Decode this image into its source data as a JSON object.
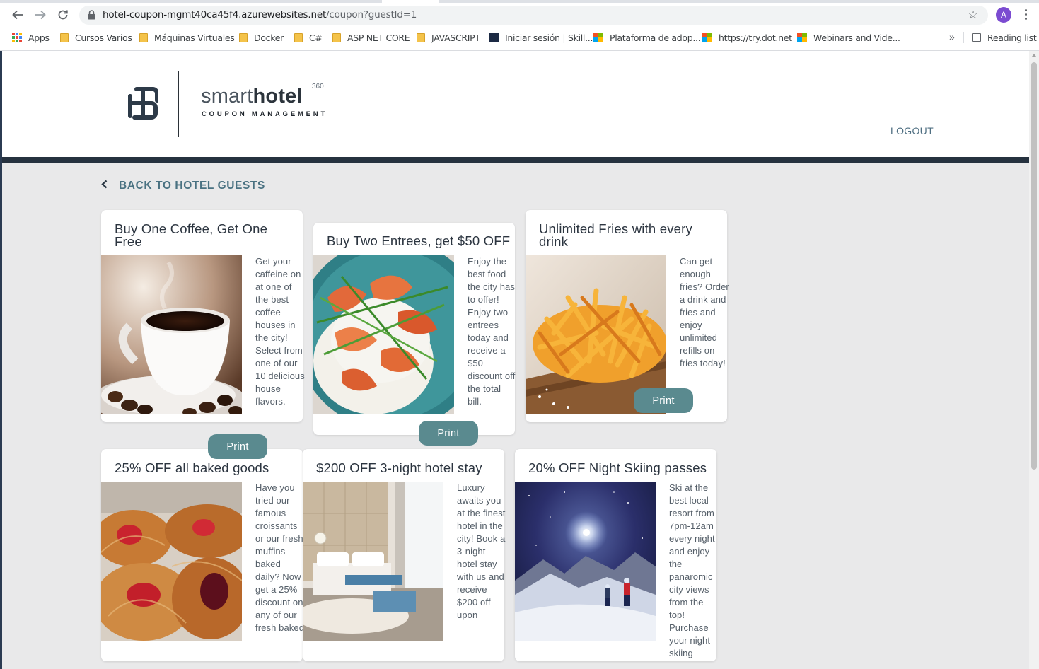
{
  "browser": {
    "url_host": "hotel-coupon-mgmt40ca45f4.azurewebsites.net",
    "url_path": "/coupon?guestId=1",
    "profile_initial": "A",
    "bookmarks": [
      {
        "label": "Apps",
        "icon": "apps-grid-icon"
      },
      {
        "label": "Cursos Varios",
        "icon": "folder-icon"
      },
      {
        "label": "Máquinas Virtuales",
        "icon": "folder-icon"
      },
      {
        "label": "Docker",
        "icon": "folder-icon"
      },
      {
        "label": "C#",
        "icon": "folder-icon"
      },
      {
        "label": "ASP NET CORE",
        "icon": "folder-icon"
      },
      {
        "label": "JAVASCRIPT",
        "icon": "folder-icon"
      },
      {
        "label": "Iniciar sesión | Skill...",
        "icon": "skillsoft-icon"
      },
      {
        "label": "Plataforma de adop...",
        "icon": "microsoft-icon"
      },
      {
        "label": "https://try.dot.net",
        "icon": "microsoft-icon"
      },
      {
        "label": "Webinars and Vide...",
        "icon": "microsoft-icon"
      }
    ],
    "reading_list": "Reading list"
  },
  "header": {
    "brand_light": "smart",
    "brand_bold": "hotel",
    "brand_sup": "360",
    "brand_sub": "COUPON MANAGEMENT",
    "logout": "LOGOUT"
  },
  "back_link": "BACK TO HOTEL GUESTS",
  "coupons": [
    {
      "title": "Buy One Coffee, Get One Free",
      "description": "Get your caffeine on at one of the best coffee houses in the city! Select from one of our 10 delicious house flavors.",
      "print": "Print",
      "image": "coffee-cup-image"
    },
    {
      "title": "Buy Two Entrees, get $50 OFF",
      "description": "Enjoy the best food the city has to offer! Enjoy two entrees today and receive a $50 discount off the total bill.",
      "print": "Print",
      "image": "shrimp-entree-image"
    },
    {
      "title": "Unlimited Fries with every drink",
      "description": "Can get enough fries? Order a drink and fries and enjoy unlimited refills on fries today!",
      "print": "Print",
      "image": "french-fries-image"
    },
    {
      "title": "25% OFF all baked goods",
      "description": "Have you tried our famous croissants or our fresh muffins baked daily? Now get a 25% discount on any of our fresh baked",
      "image": "pastries-image"
    },
    {
      "title": "$200 OFF 3-night hotel stay",
      "description": "Luxury awaits you at the finest hotel in the city! Book a 3-night hotel stay with us and receive $200 off upon",
      "image": "hotel-room-image"
    },
    {
      "title": "20% OFF Night Skiing passes",
      "description": "Ski at the best local resort from 7pm-12am every night and enjoy the panaromic city views from the top! Purchase your night skiing",
      "image": "night-skiing-image"
    }
  ]
}
